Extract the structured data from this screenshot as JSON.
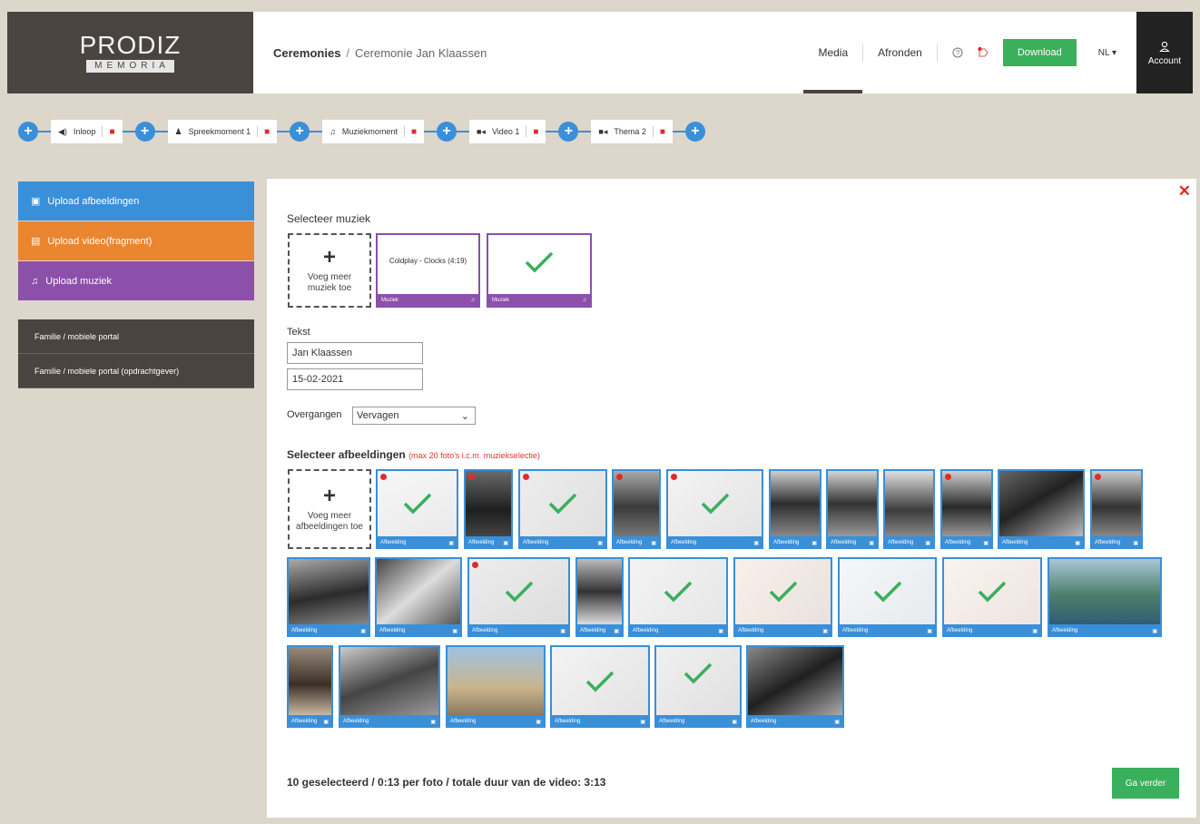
{
  "header": {
    "logo_main": "PRODIZ",
    "logo_sub": "MEMORIA",
    "breadcrumb_root": "Ceremonies",
    "breadcrumb_sep": "/",
    "breadcrumb_current": "Ceremonie Jan Klaassen",
    "tabs": [
      {
        "label": "Media",
        "active": true
      },
      {
        "label": "Afronden",
        "active": false
      }
    ],
    "download_label": "Download",
    "language": "NL",
    "account_label": "Account"
  },
  "timeline": [
    {
      "label": "Inloop",
      "icon": "speaker-icon"
    },
    {
      "label": "Spreekmoment 1",
      "icon": "user-icon"
    },
    {
      "label": "Muziekmoment",
      "icon": "music-icon"
    },
    {
      "label": "Video 1",
      "icon": "video-icon"
    },
    {
      "label": "Thema 2",
      "icon": "video-icon"
    }
  ],
  "sidebar": {
    "upload_images": "Upload afbeeldingen",
    "upload_video": "Upload video(fragment)",
    "upload_music": "Upload muziek",
    "links": [
      "Familie / mobiele portal",
      "Familie / mobiele portal (opdrachtgever)"
    ]
  },
  "main": {
    "music_heading": "Selecteer muziek",
    "add_music_label": "Voeg meer muziek toe",
    "music_items": [
      {
        "title": "Coldplay - Clocks (4:19)",
        "tag": "Muziek",
        "selected": false
      },
      {
        "title": "",
        "tag": "Muziek",
        "selected": true
      }
    ],
    "text_heading": "Tekst",
    "text_name": "Jan Klaassen",
    "text_date": "15-02-2021",
    "transitions_label": "Overgangen",
    "transitions_value": "Vervagen",
    "images_heading": "Selecteer afbeeldingen",
    "images_note": "(max 20 foto's i.c.m. muziekselectie)",
    "add_images_label": "Voeg meer afbeeldingen toe",
    "image_tag": "Afbeelding",
    "summary": "10 geselecteerd / 0:13 per foto / totale duur van de video: 3:13",
    "continue_label": "Ga verder"
  },
  "colors": {
    "accent_blue": "#3a8fd9",
    "orange": "#ea8530",
    "purple": "#8c4faa",
    "green": "#3aaf5c",
    "red": "#e02b2b",
    "dark": "#4a4440"
  }
}
